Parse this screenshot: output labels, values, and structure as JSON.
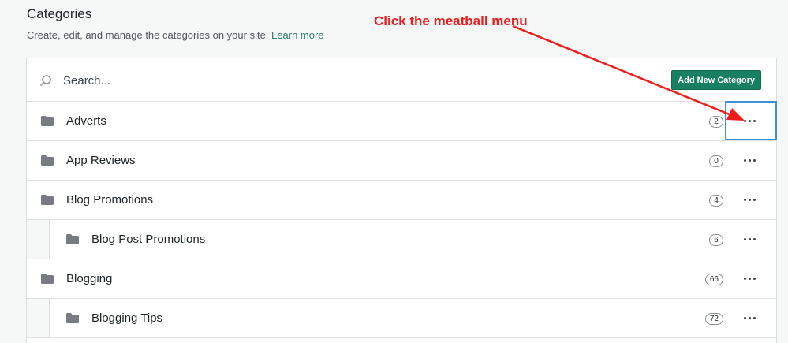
{
  "page": {
    "title": "Categories",
    "subtitle": "Create, edit, and manage the categories on your site.",
    "learn_more": "Learn more"
  },
  "search": {
    "placeholder": "Search..."
  },
  "add_button": "Add New Category",
  "annotation": "Click the meatball menu",
  "categories": [
    {
      "name": "Adverts",
      "count": "2",
      "child": false
    },
    {
      "name": "App Reviews",
      "count": "0",
      "child": false
    },
    {
      "name": "Blog Promotions",
      "count": "4",
      "child": false
    },
    {
      "name": "Blog Post Promotions",
      "count": "6",
      "child": true
    },
    {
      "name": "Blogging",
      "count": "66",
      "child": false
    },
    {
      "name": "Blogging Tips",
      "count": "72",
      "child": true
    }
  ],
  "colors": {
    "accent_button": "#188062",
    "link": "#2a7e6c",
    "annotation": "#ee1c1c",
    "highlight": "#3d8fd8"
  },
  "icons": {
    "search": "search-icon",
    "folder": "folder-icon",
    "menu": "meatball-menu-icon"
  }
}
